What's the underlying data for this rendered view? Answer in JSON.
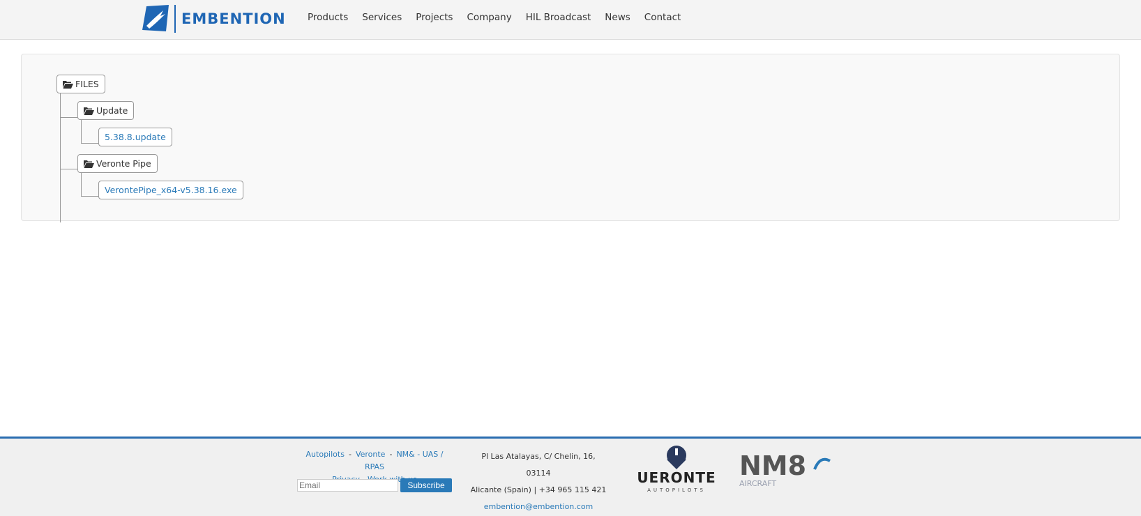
{
  "header": {
    "brand": "EMBENTION",
    "nav": [
      "Products",
      "Services",
      "Projects",
      "Company",
      "HIL Broadcast",
      "News",
      "Contact"
    ]
  },
  "tree": {
    "root": "FILES",
    "update_folder": "Update",
    "update_file": "5.38.8.update",
    "pipe_folder": "Veronte Pipe",
    "pipe_file": "VerontePipe_x64-v5.38.16.exe"
  },
  "footer": {
    "link_autopilots": "Autopilots",
    "link_veronte": "Veronte",
    "link_nm8": "NM& - UAS / RPAS",
    "link_privacy": "Privacy",
    "link_work": "Work with us",
    "email_placeholder": "Email",
    "subscribe_label": "Subscribe",
    "address_line1": "Pl Las Atalayas, C/ Chelin, 16, 03114",
    "address_line2": "Alicante (Spain) | +34 965 115 421",
    "email": "embention@embention.com",
    "veronte_logo_main": "UERONTE",
    "veronte_logo_sub": "AUTOPILOTS",
    "nm8_logo_main": "NM8",
    "nm8_logo_sub": "AIRCRAFT"
  },
  "colors": {
    "brand_blue": "#1f66b4",
    "link_blue": "#2a7ab8",
    "header_bg": "#f4f4f4",
    "footer_bg": "#f0f0f0"
  },
  "icons": [
    "embention-logo-icon",
    "folder-open-icon",
    "veronte-logo-icon",
    "nm8-logo-icon"
  ]
}
